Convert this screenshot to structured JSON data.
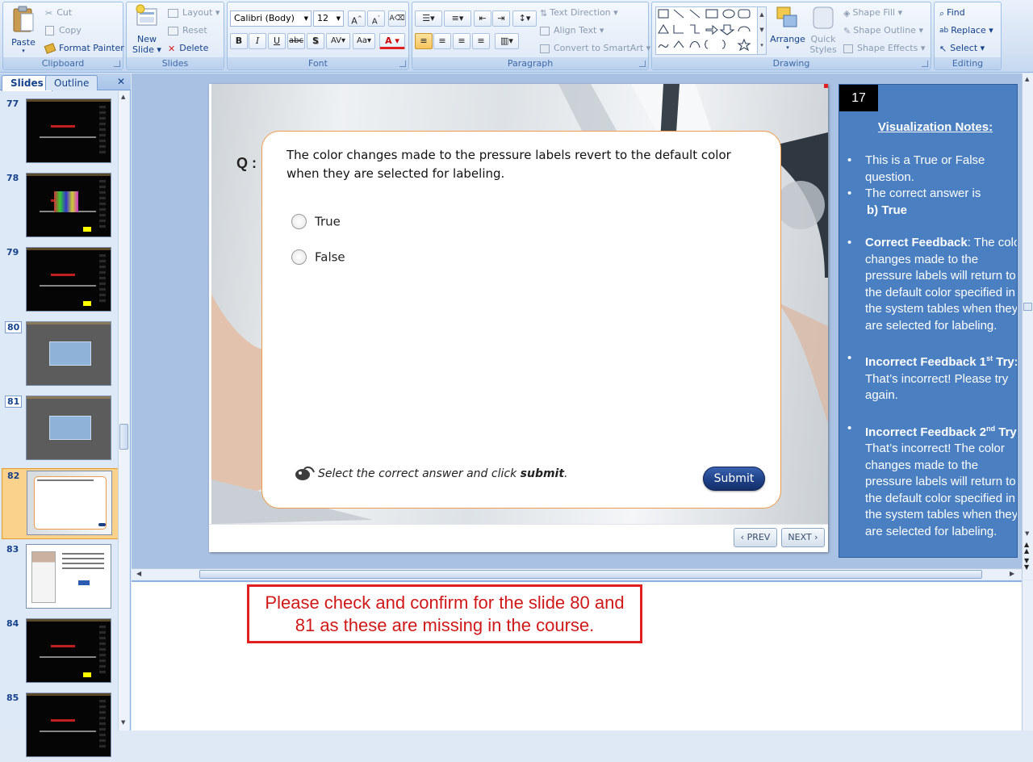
{
  "ribbon": {
    "clipboard": {
      "title": "Clipboard",
      "paste": "Paste",
      "cut": "Cut",
      "copy": "Copy",
      "format_painter": "Format Painter"
    },
    "slides": {
      "title": "Slides",
      "new_slide": "New",
      "new_slide2": "Slide",
      "layout": "Layout",
      "reset": "Reset",
      "delete": "Delete"
    },
    "font": {
      "title": "Font",
      "family": "Calibri (Body)",
      "size": "12"
    },
    "paragraph": {
      "title": "Paragraph",
      "text_direction": "Text Direction",
      "align_text": "Align Text",
      "convert_smartart": "Convert to SmartArt"
    },
    "drawing": {
      "title": "Drawing",
      "arrange": "Arrange",
      "quick_styles": "Quick",
      "quick_styles2": "Styles",
      "shape_fill": "Shape Fill",
      "shape_outline": "Shape Outline",
      "shape_effects": "Shape Effects"
    },
    "editing": {
      "title": "Editing",
      "find": "Find",
      "replace": "Replace",
      "select": "Select"
    }
  },
  "panel_tabs": {
    "slides": "Slides",
    "outline": "Outline"
  },
  "thumbnails": [
    {
      "num": "77",
      "style": "dark"
    },
    {
      "num": "78",
      "style": "dark-chart"
    },
    {
      "num": "79",
      "style": "dark"
    },
    {
      "num": "80",
      "style": "gray-box",
      "boxed": true
    },
    {
      "num": "81",
      "style": "gray-box",
      "boxed": true
    },
    {
      "num": "82",
      "style": "quiz",
      "selected": true
    },
    {
      "num": "83",
      "style": "doctor"
    },
    {
      "num": "84",
      "style": "dark"
    },
    {
      "num": "85",
      "style": "dark"
    }
  ],
  "slide": {
    "q_label": "Q :",
    "question": "The color changes made to the pressure labels revert to the default color when they are selected  for labeling.",
    "options": [
      "True",
      "False"
    ],
    "instruction_prefix": "Select the correct answer and click ",
    "instruction_bold": "submit",
    "instruction_suffix": ".",
    "submit": "Submit",
    "prev": "PREV",
    "next": "NEXT"
  },
  "viz_notes": {
    "number": "17",
    "heading": "Visualization Notes:",
    "b1": "This is a  True or False question.",
    "b2": "The correct answer is",
    "b2_answer": "b) True",
    "b3_label": "Correct Feedback",
    "b3_text": ":  The color changes made to the pressure labels will return to the default color specified in the system tables when they are selected for labeling.",
    "b4_label": "Incorrect Feedback 1",
    "b4_sup": "st",
    "b4_label_end": " Try:",
    "b4_text": "That’s incorrect! Please try again.",
    "b5_label": "Incorrect Feedback 2",
    "b5_sup": "nd",
    "b5_label_end": " Try",
    "b5_text": "That’s incorrect! The color changes made to the pressure labels will return to the default color specified in the system tables when they are selected for labeling."
  },
  "notes": {
    "comment": "Please check and confirm for the slide 80 and 81 as these are missing in the course."
  },
  "colors": {
    "accent": "#ef9b4b",
    "submit": "#1d3f84",
    "comment_border": "#e02020",
    "comment_text": "#d01818"
  }
}
